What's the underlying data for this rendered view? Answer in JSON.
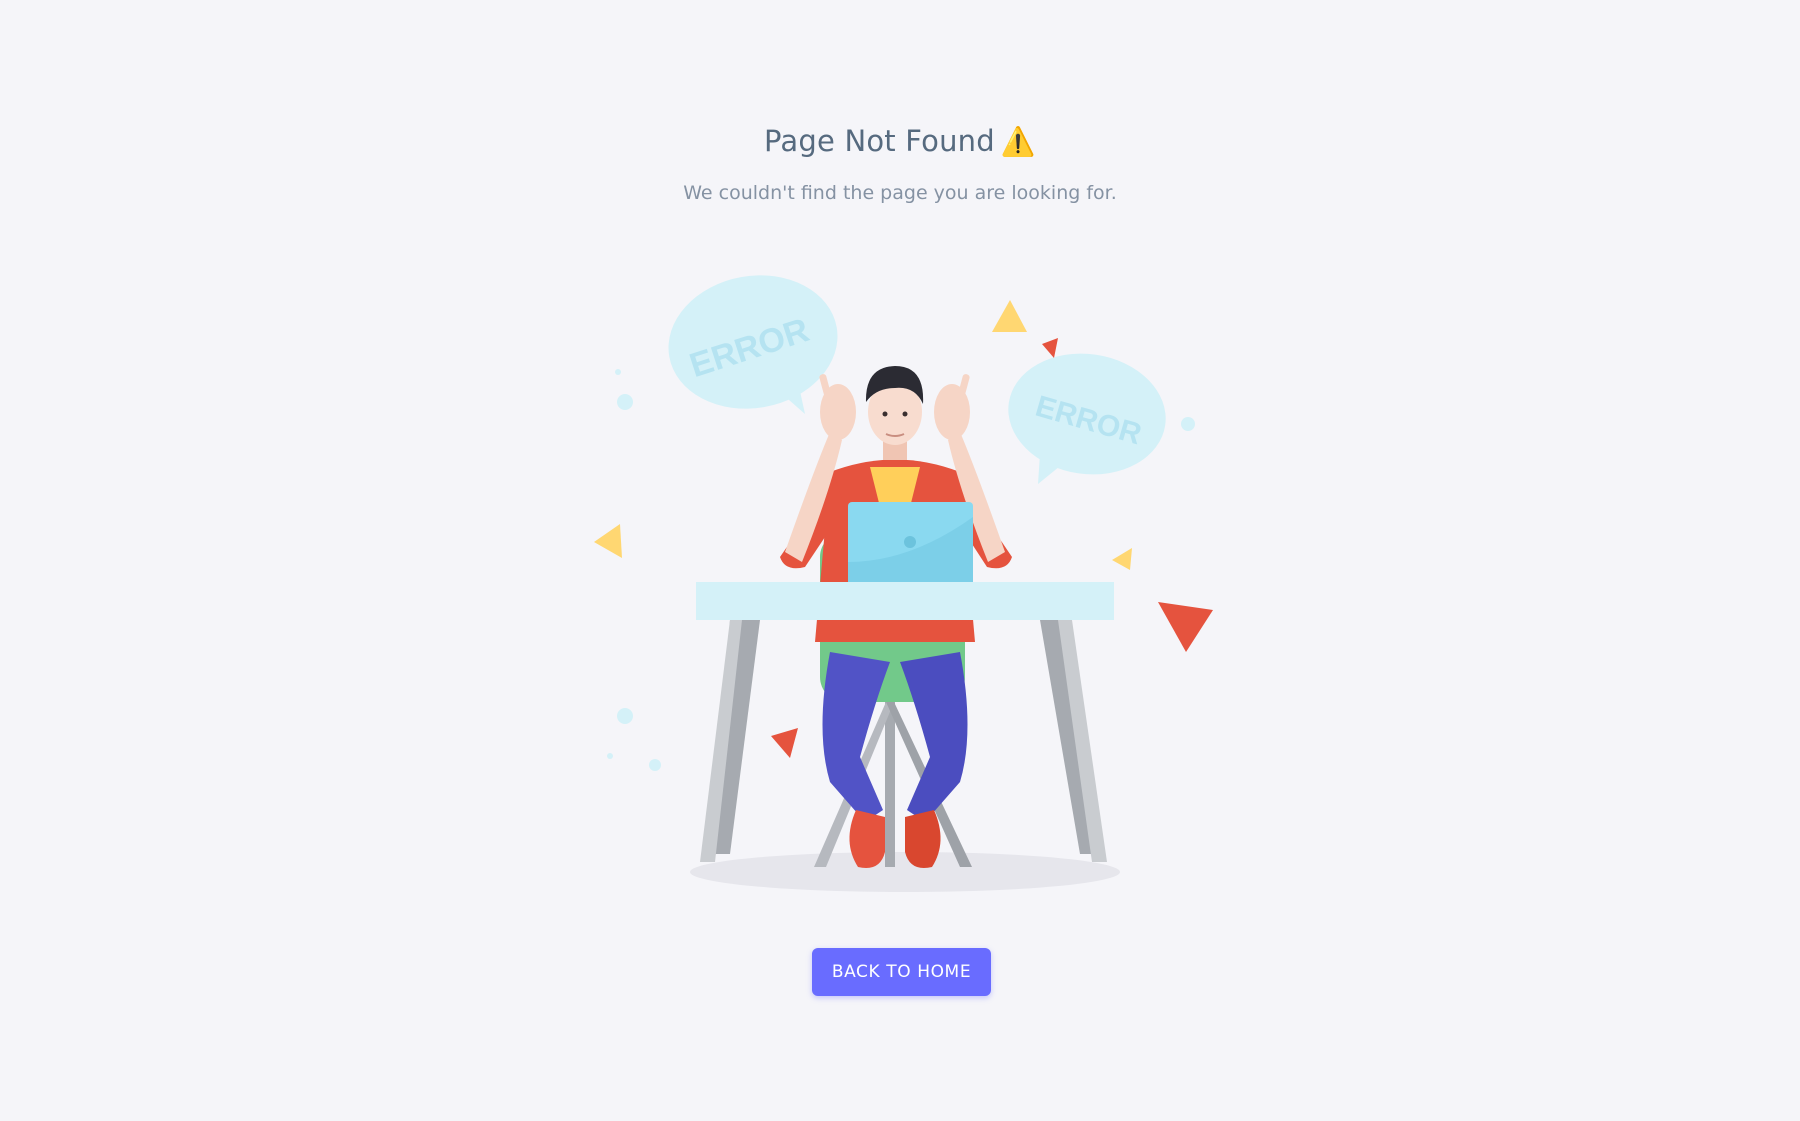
{
  "page": {
    "title": "Page Not Found",
    "title_icon": "warning-icon",
    "subtitle": "We couldn't find the page you are looking for.",
    "button_label": "BACK TO HOME"
  },
  "illustration": {
    "bubble_text_left": "ERROR",
    "bubble_text_right": "ERROR"
  },
  "colors": {
    "background": "#f5f5f9",
    "title": "#566a7f",
    "subtitle": "#8592a3",
    "primary": "#696cff"
  }
}
